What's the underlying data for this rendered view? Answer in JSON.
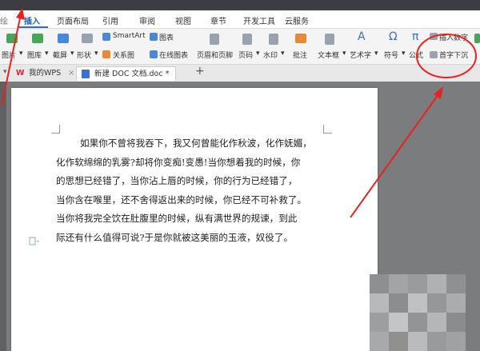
{
  "menu": {
    "left_cut": "绘",
    "tabs": [
      "插入",
      "页面布局",
      "引用",
      "审阅",
      "视图",
      "章节",
      "开发工具",
      "云服务"
    ]
  },
  "ribbon": {
    "items": {
      "picture": "图片",
      "library": "图库",
      "screenshot": "截屏",
      "shapes": "形状",
      "smartart": "SmartArt",
      "chart": "图表",
      "relation": "关系图",
      "online_chart": "在线图表",
      "header_footer": "页眉和页脚",
      "page_number": "页码",
      "watermark": "水印",
      "comment": "批注",
      "textbox": "文本框",
      "wordart": "艺术字",
      "symbol": "符号",
      "formula": "公式",
      "insert_number": "插入数字",
      "drop_cap": "首字下沉"
    },
    "dropdown_marker": "▾",
    "omega_glyph": "Ω",
    "pi_glyph": "π",
    "wordart_glyph": "A"
  },
  "tabs": {
    "wps": "我的WPS",
    "doc": "新建 DOC 文档.doc *",
    "add": "+"
  },
  "document": {
    "lines": [
      "如果你不曾将我吞下，我又何曾能化作秋波，化作妩媚，",
      "化作软绵绵的乳雾?却将你变痴!变愚!当你想着我的时候，你",
      "的思想已经错了，当你沾上唇的时候，你的行为已经错了，",
      "当你含在喉里，还不舍得返出来的时候，你已经不可补救了。",
      "当你将我完全饮在肚腹里的时候，纵有满世界的规谏，到此",
      "际还有什么值得可说?于是你就被这美丽的玉液，奴役了。"
    ]
  },
  "colors": {
    "accent": "#2b6cd4",
    "annotation": "#e8231f",
    "page": "#ffffff",
    "workspace": "#7a7c7e"
  }
}
